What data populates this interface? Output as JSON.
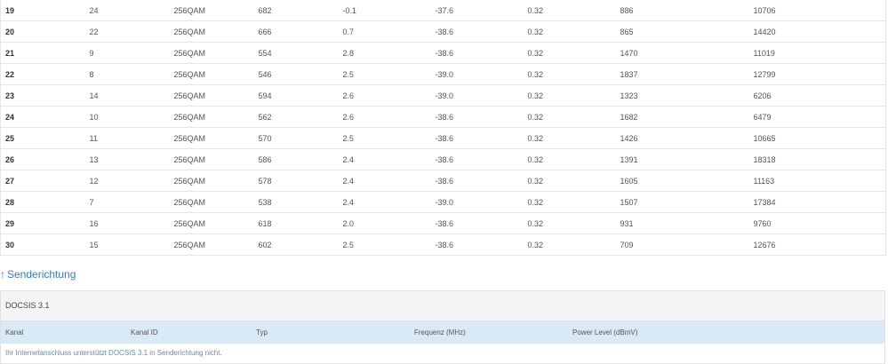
{
  "downstream_rows": [
    [
      "19",
      "24",
      "256QAM",
      "682",
      "-0.1",
      "-37.6",
      "0.32",
      "886",
      "10706"
    ],
    [
      "20",
      "22",
      "256QAM",
      "666",
      "0.7",
      "-38.6",
      "0.32",
      "865",
      "14420"
    ],
    [
      "21",
      "9",
      "256QAM",
      "554",
      "2.8",
      "-38.6",
      "0.32",
      "1470",
      "11019"
    ],
    [
      "22",
      "8",
      "256QAM",
      "546",
      "2.5",
      "-39.0",
      "0.32",
      "1837",
      "12799"
    ],
    [
      "23",
      "14",
      "256QAM",
      "594",
      "2.6",
      "-39.0",
      "0.32",
      "1323",
      "6206"
    ],
    [
      "24",
      "10",
      "256QAM",
      "562",
      "2.6",
      "-38.6",
      "0.32",
      "1682",
      "6479"
    ],
    [
      "25",
      "11",
      "256QAM",
      "570",
      "2.5",
      "-38.6",
      "0.32",
      "1426",
      "10665"
    ],
    [
      "26",
      "13",
      "256QAM",
      "586",
      "2.4",
      "-38.6",
      "0.32",
      "1391",
      "18318"
    ],
    [
      "27",
      "12",
      "256QAM",
      "578",
      "2.4",
      "-38.6",
      "0.32",
      "1605",
      "11163"
    ],
    [
      "28",
      "7",
      "256QAM",
      "538",
      "2.4",
      "-39.0",
      "0.32",
      "1507",
      "17384"
    ],
    [
      "29",
      "16",
      "256QAM",
      "618",
      "2.0",
      "-38.6",
      "0.32",
      "931",
      "9760"
    ],
    [
      "30",
      "15",
      "256QAM",
      "602",
      "2.5",
      "-38.6",
      "0.32",
      "709",
      "12676"
    ]
  ],
  "upstream": {
    "link_arrow": "↑",
    "link_label": "Senderichtung",
    "panel_title": "DOCSIS 3.1",
    "columns": [
      "Kanal",
      "Kanal ID",
      "Typ",
      "Frequenz (MHz)",
      "Power Level (dBmV)"
    ],
    "message": "Ihr Internetanschluss unterstützt DOCSIS 3.1 in Senderichtung nicht."
  }
}
